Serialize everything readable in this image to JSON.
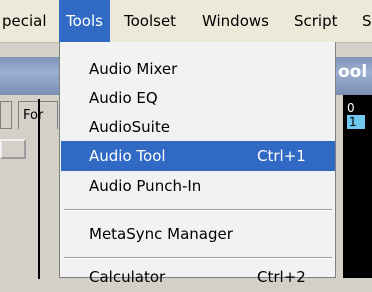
{
  "menubar": {
    "items": [
      {
        "label": "pecial",
        "active": false
      },
      {
        "label": "Tools",
        "active": true
      },
      {
        "label": "Toolset",
        "active": false
      },
      {
        "label": "Windows",
        "active": false
      },
      {
        "label": "Script",
        "active": false
      },
      {
        "label": "S",
        "active": false
      }
    ]
  },
  "background_window": {
    "title_fragment": "ool",
    "tab_fragment": "For",
    "counters": [
      "0",
      "1"
    ]
  },
  "tools_menu": {
    "items": [
      {
        "label": "Audio Mixer",
        "shortcut": ""
      },
      {
        "label": "Audio EQ",
        "shortcut": ""
      },
      {
        "label": "AudioSuite",
        "shortcut": ""
      },
      {
        "label": "Audio Tool",
        "shortcut": "Ctrl+1",
        "selected": true
      },
      {
        "label": "Audio Punch-In",
        "shortcut": ""
      },
      {
        "label": "MetaSync Manager",
        "shortcut": ""
      },
      {
        "label": "Calculator",
        "shortcut": "Ctrl+2"
      }
    ]
  },
  "colors": {
    "selection": "#316ac5",
    "menu_background": "#f2f2f2",
    "menubar_background": "#ece9d8"
  }
}
